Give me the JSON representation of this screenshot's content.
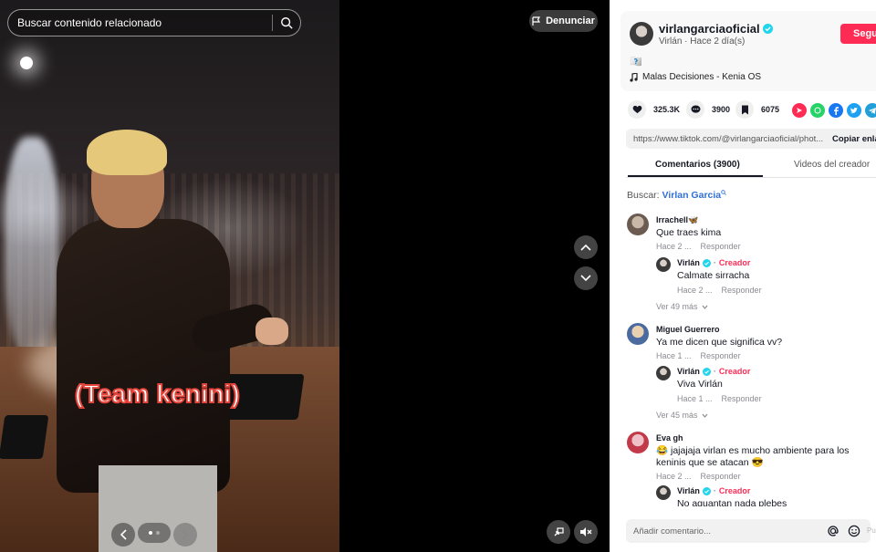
{
  "search": {
    "placeholder": "Buscar contenido relacionado"
  },
  "media": {
    "report_label": "Denunciar",
    "caption": "(Team kenini)"
  },
  "creator": {
    "username": "virlangarciaoficial",
    "display_name": "Virlán",
    "posted": "Hace 2 día(s)",
    "follow_label": "Segu",
    "description": "🇽🇽",
    "music": "Malas Decisiones - Kenia OS"
  },
  "stats": {
    "likes": "325.3K",
    "comments": "3900",
    "saves": "6075"
  },
  "share": {
    "url": "https://www.tiktok.com/@virlangarciaoficial/phot...",
    "copy_label": "Copiar enla"
  },
  "tabs": {
    "comments": "Comentarios (3900)",
    "creator_videos": "Videos del creador"
  },
  "comment_search": {
    "label": "Buscar:",
    "term": "Virlan Garcia"
  },
  "comments": [
    {
      "user": "Irrachell🦋",
      "text": "Que traes kima",
      "time": "Hace 2 ...",
      "reply": "Responder",
      "creator_reply": {
        "user": "Virlán",
        "tag": "Creador",
        "text": "Calmate sirracha",
        "time": "Hace 2 ...",
        "reply": "Responder"
      },
      "more": "Ver 49 más"
    },
    {
      "user": "Miguel Guerrero",
      "text": "Ya me dicen que significa vv?",
      "time": "Hace 1 ...",
      "reply": "Responder",
      "creator_reply": {
        "user": "Virlán",
        "tag": "Creador",
        "text": "Viva Virlán",
        "time": "Hace 1 ...",
        "reply": "Responder"
      },
      "more": "Ver 45 más"
    },
    {
      "user": "Eva gh",
      "text_line1": "😂 jajajaja virlan es mucho ambiente para los",
      "text_line2": "keninis que se atacan 😎",
      "time": "Hace 2 ...",
      "reply": "Responder",
      "creator_reply": {
        "user": "Virlán",
        "tag": "Creador",
        "text": "No aguantan nada plebes"
      }
    }
  ],
  "composer": {
    "placeholder": "Añadir comentario...",
    "post_label": "Pu"
  },
  "colors": {
    "accent": "#fe2c55",
    "link": "#2f6fd6",
    "verified": "#20d5ec"
  }
}
